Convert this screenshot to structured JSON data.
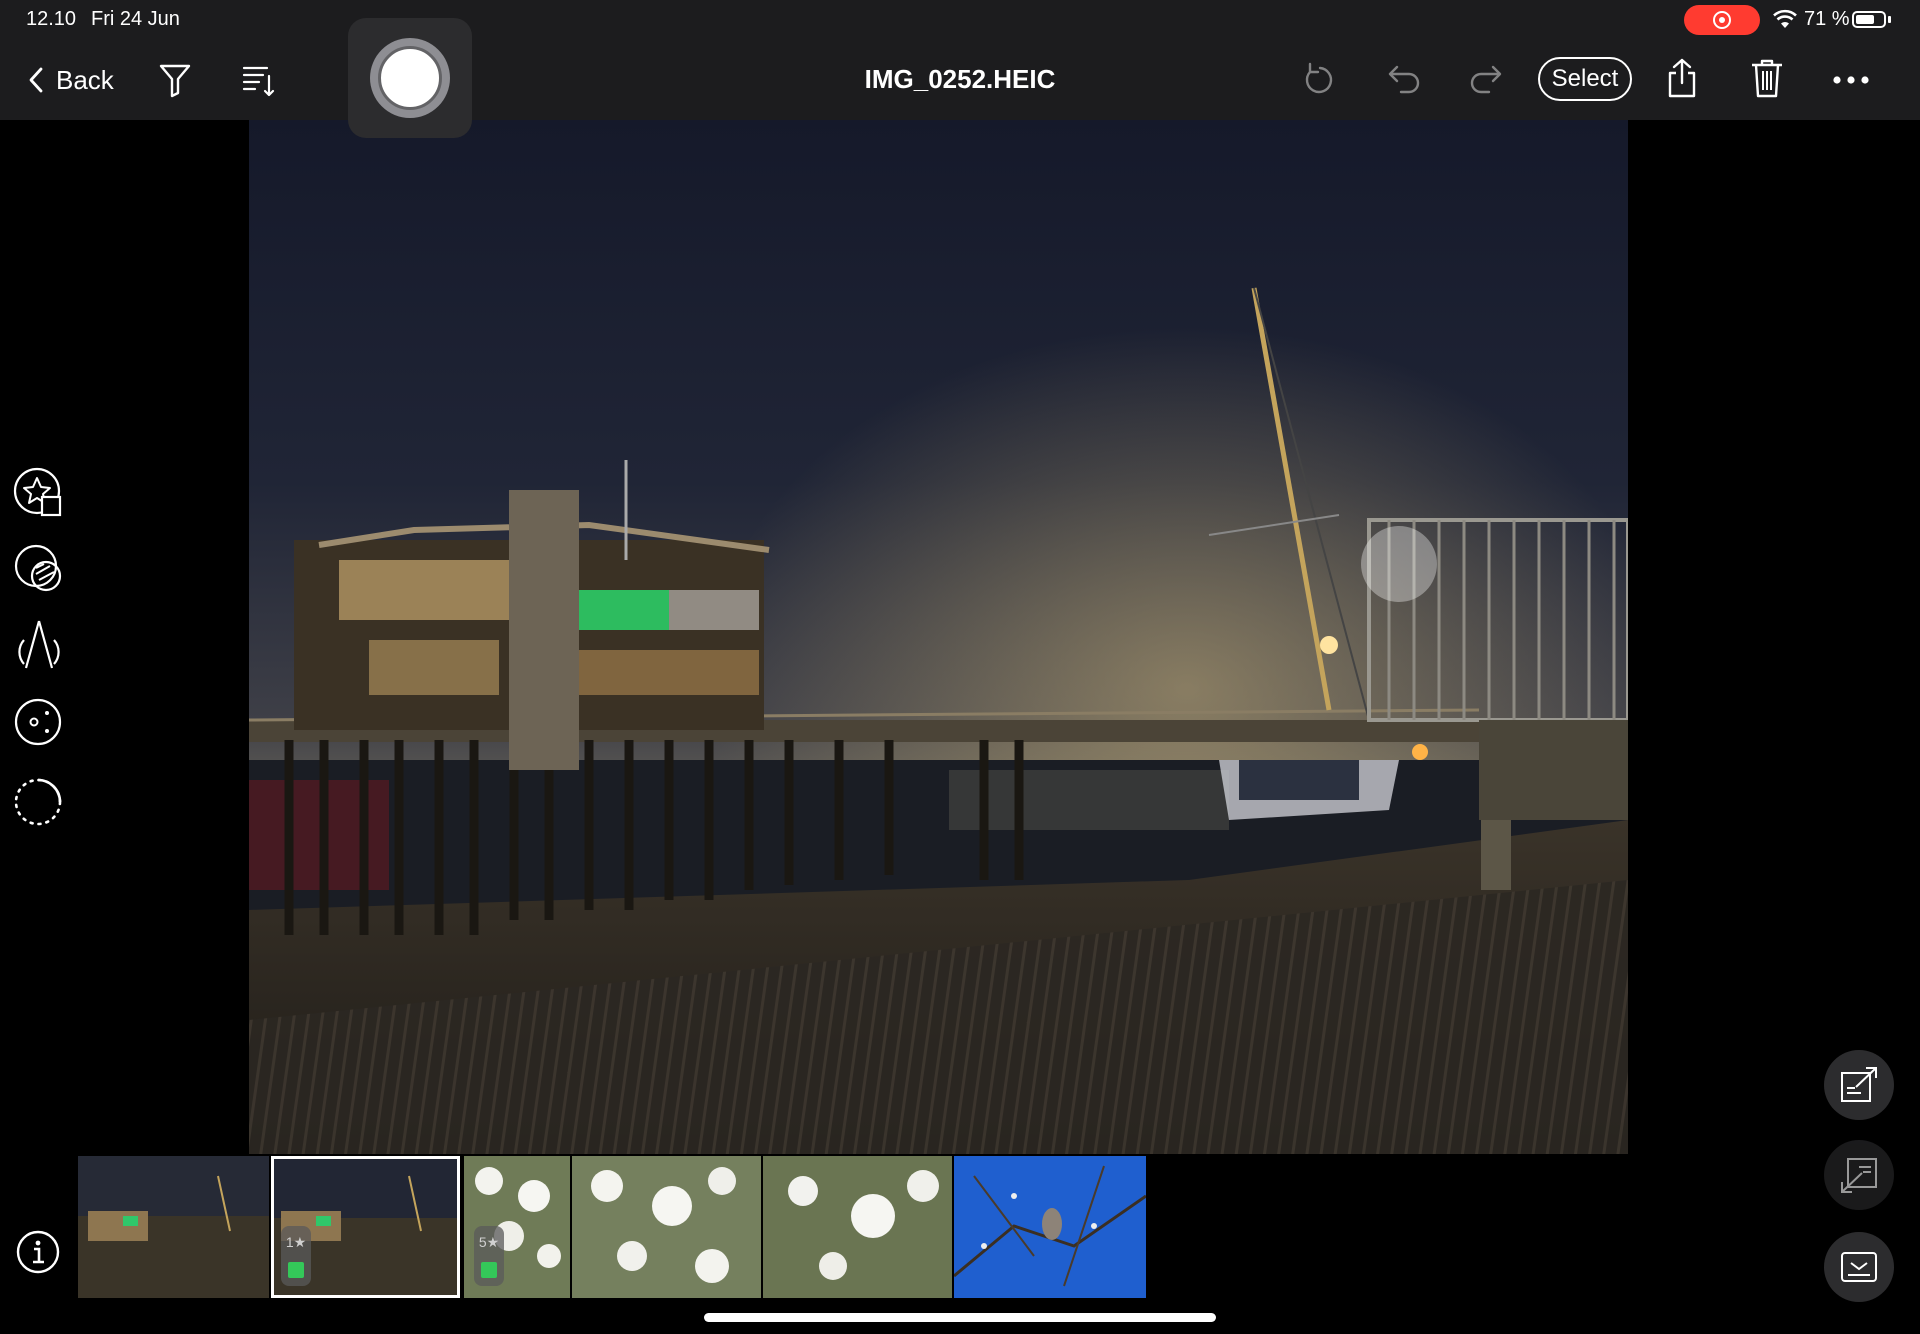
{
  "status_bar": {
    "time": "12.10",
    "date": "Fri 24 Jun",
    "battery_text": "71 %",
    "battery_level": 0.71,
    "record_color": "#ff3b30"
  },
  "toolbar": {
    "back_label": "Back",
    "title": "IMG_0252.HEIC",
    "select_label": "Select",
    "icons": [
      "filter-icon",
      "sort-icon",
      "capture-button",
      "rotate-icon",
      "undo-icon",
      "redo-icon",
      "share-icon",
      "trash-icon",
      "more-icon"
    ]
  },
  "left_tools": [
    "star-edit-icon",
    "mask-icon",
    "perspective-icon",
    "lens-icon",
    "lasso-icon"
  ],
  "right_buttons": [
    "export-icon",
    "import-icon",
    "keyboard-icon"
  ],
  "filmstrip": {
    "thumbnails": [
      {
        "scene": "night-pier",
        "selected": false,
        "rating": "",
        "color_label": ""
      },
      {
        "scene": "night-pier",
        "selected": true,
        "rating": "1",
        "color_label": "#34c759"
      },
      {
        "scene": "white-blossom",
        "selected": false,
        "rating": "5",
        "color_label": "#34c759"
      },
      {
        "scene": "white-blossom",
        "selected": false,
        "rating": "",
        "color_label": ""
      },
      {
        "scene": "white-blossom",
        "selected": false,
        "rating": "",
        "color_label": ""
      },
      {
        "scene": "bird-on-branch",
        "selected": false,
        "rating": "",
        "color_label": ""
      }
    ]
  },
  "colors": {
    "toolbar_bg": "#1c1c1e",
    "accent_green": "#34c759"
  }
}
